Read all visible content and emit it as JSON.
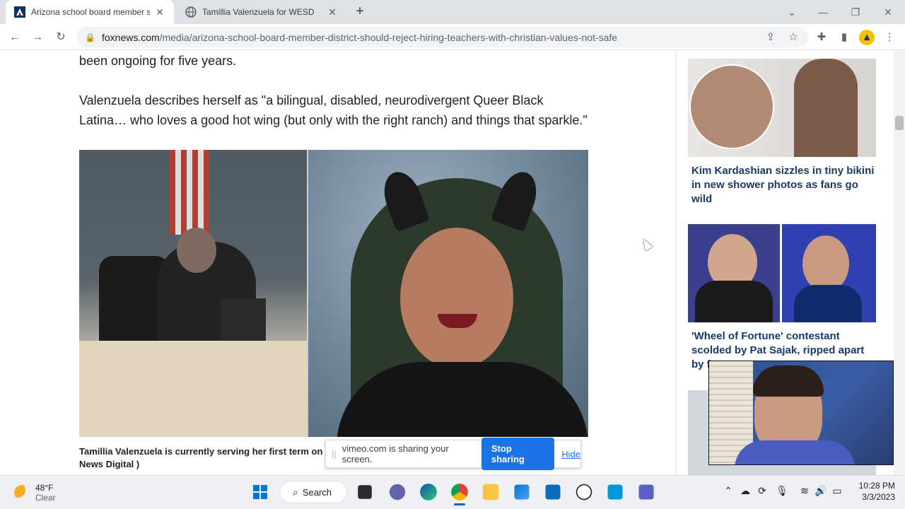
{
  "browser": {
    "tabs": [
      {
        "title": "Arizona school board member sa",
        "active": true
      },
      {
        "title": "Tamillia Valenzuela for WESD",
        "active": false
      }
    ],
    "url_host": "foxnews.com",
    "url_path": "/media/arizona-school-board-member-district-should-reject-hiring-teachers-with-christian-values-not-safe"
  },
  "article": {
    "paragraph_partial": "been ongoing for five years.",
    "paragraph_quote": "Valenzuela describes herself as \"a bilingual, disabled, neurodivergent Queer Black Latina… who loves a good hot wing (but only with the right ranch) and things that sparkle.\"",
    "caption": "Tamillia Valenzuela is currently serving her first term on the",
    "caption_line2": "News Digital )"
  },
  "sidebar": {
    "stories": [
      {
        "title": "Kim Kardashian sizzles in tiny bikini in new shower photos as fans go wild"
      },
      {
        "title": "'Wheel of Fortune' contestant scolded by Pat Sajak, ripped apart by f"
      }
    ]
  },
  "share_bar": {
    "message": "vimeo.com is sharing your screen.",
    "stop_label": "Stop sharing",
    "hide_label": "Hide"
  },
  "taskbar": {
    "weather_temp": "48°F",
    "weather_desc": "Clear",
    "search_label": "Search",
    "time": "10:28 PM",
    "date": "3/3/2023"
  },
  "colors": {
    "link_blue": "#1a73e8",
    "headline_navy": "#183a6b"
  }
}
